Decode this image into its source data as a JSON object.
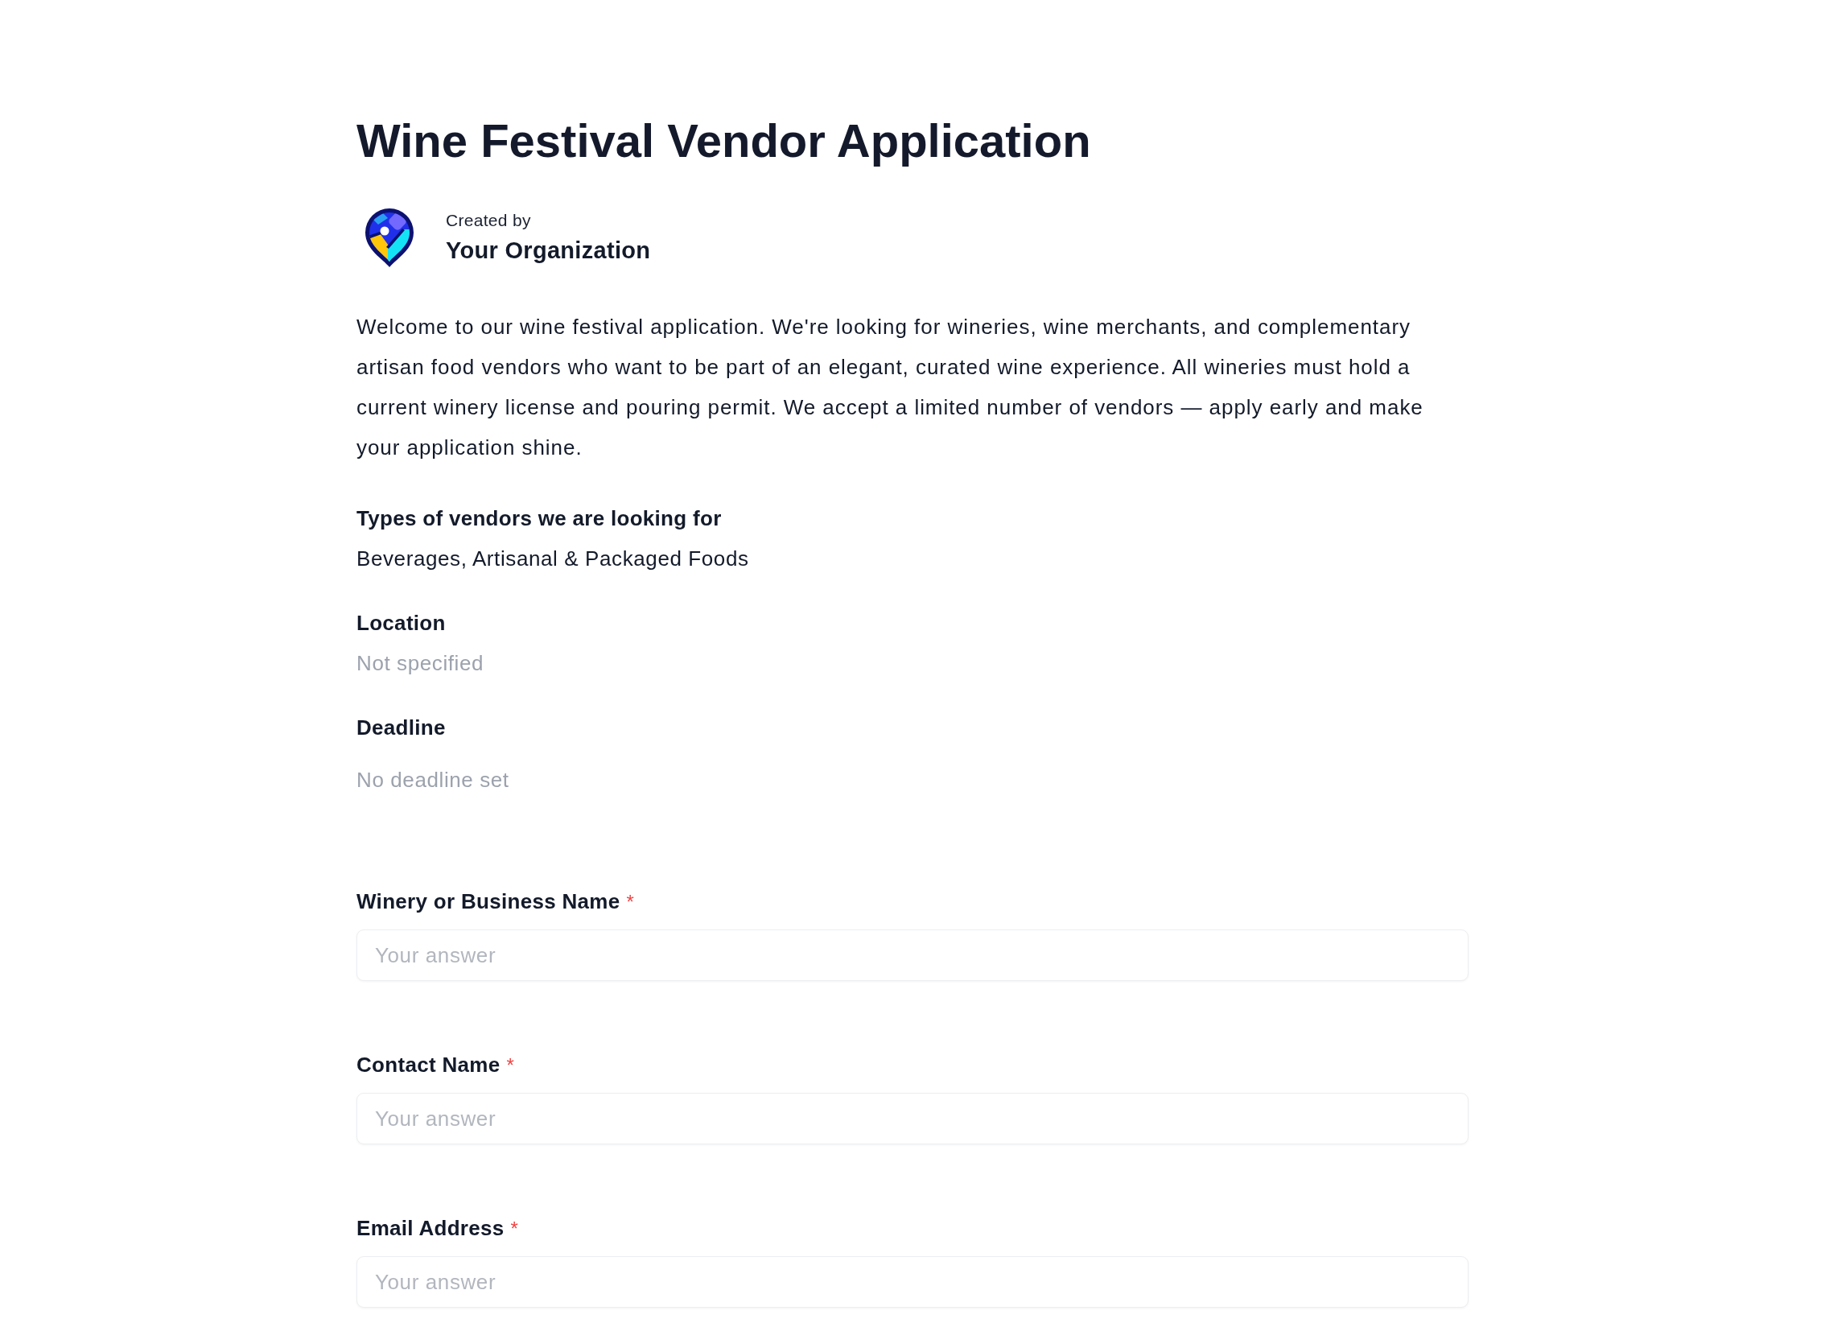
{
  "title": "Wine Festival Vendor Application",
  "organizer": {
    "caption": "Created by",
    "name": "Your Organization"
  },
  "description": "Welcome to our wine festival application. We're looking for wineries, wine merchants, and complementary artisan food vendors who want to be part of an elegant, curated wine experience. All wineries must hold a current winery license and pouring permit. We accept a limited number of vendors — apply early and make your application shine.",
  "details": [
    {
      "kind": "text",
      "label": "Types of vendors we are looking for",
      "value": "Beverages, Artisanal & Packaged Foods",
      "muted": false
    },
    {
      "kind": "text",
      "label": "Location",
      "value": "Not specified",
      "muted": true
    },
    {
      "kind": "date",
      "label": "Deadline",
      "value": "No deadline set",
      "muted": true
    }
  ],
  "questions": [
    {
      "label": "Winery or Business Name",
      "required_mark": "*",
      "placeholder": "Your answer"
    },
    {
      "label": "Contact Name",
      "required_mark": "*",
      "placeholder": "Your answer"
    },
    {
      "label": "Email Address",
      "required_mark": "*",
      "placeholder": "Your answer"
    }
  ]
}
